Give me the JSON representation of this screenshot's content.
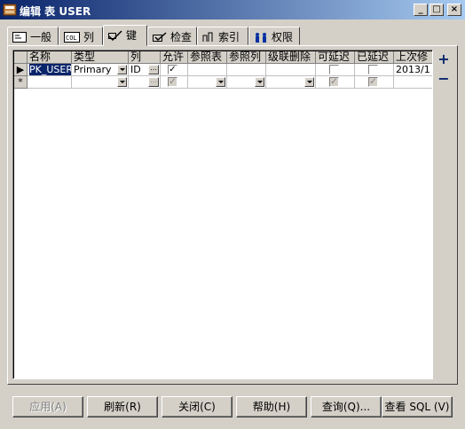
{
  "window": {
    "title": "编辑 表 USER",
    "controls": {
      "minimize": "_",
      "maximize": "□",
      "close": "×"
    }
  },
  "tabs": [
    {
      "label": "一般",
      "icon": "general-icon",
      "active": false
    },
    {
      "label": "列",
      "icon": "column-icon",
      "active": false
    },
    {
      "label": "键",
      "icon": "key-icon",
      "active": true
    },
    {
      "label": "检查",
      "icon": "check-icon",
      "active": false
    },
    {
      "label": "索引",
      "icon": "index-icon",
      "active": false
    },
    {
      "label": "权限",
      "icon": "permission-icon",
      "active": false
    }
  ],
  "grid": {
    "columns": [
      "名称",
      "类型",
      "列",
      "允许",
      "参照表",
      "参照列",
      "级联删除",
      "可延迟",
      "已延迟",
      "上次修"
    ],
    "rows": [
      {
        "name": "PK_USER",
        "type": "Primary",
        "column": "ID",
        "allow": true,
        "ref_table": "",
        "ref_column": "",
        "cascade": "",
        "deferrable": false,
        "deferred": false,
        "last_modified": "2013/1"
      }
    ],
    "new_row_marker": "*",
    "current_row_marker": "▶"
  },
  "side": {
    "add": "+",
    "remove": "−"
  },
  "buttons": {
    "apply": "应用(A)",
    "refresh": "刷新(R)",
    "close": "关闭(C)",
    "help": "帮助(H)",
    "query": "查询(Q)...",
    "view_sql": "查看 SQL (V)"
  },
  "colors": {
    "title_start": "#0a246a",
    "title_end": "#a6caf0",
    "face": "#d4d0c8",
    "accent": "#0a246a"
  }
}
